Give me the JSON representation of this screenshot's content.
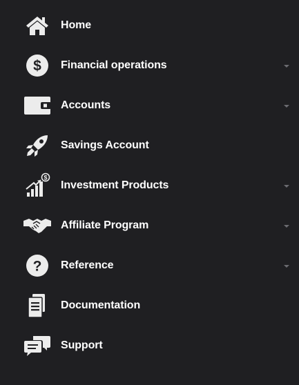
{
  "sidebar": {
    "items": [
      {
        "label": "Home",
        "icon": "home-icon",
        "has_submenu": false
      },
      {
        "label": "Financial operations",
        "icon": "dollar-icon",
        "has_submenu": true
      },
      {
        "label": "Accounts",
        "icon": "wallet-icon",
        "has_submenu": true
      },
      {
        "label": "Savings Account",
        "icon": "rocket-icon",
        "has_submenu": false
      },
      {
        "label": "Investment Products",
        "icon": "growth-chart-icon",
        "has_submenu": true
      },
      {
        "label": "Affiliate Program",
        "icon": "handshake-icon",
        "has_submenu": true
      },
      {
        "label": "Reference",
        "icon": "question-icon",
        "has_submenu": true
      },
      {
        "label": "Documentation",
        "icon": "document-icon",
        "has_submenu": false
      },
      {
        "label": "Support",
        "icon": "chat-icon",
        "has_submenu": false
      }
    ]
  },
  "colors": {
    "background": "#1f1f22",
    "text": "#ffffff",
    "icon": "#ececec",
    "chevron": "#6b6b70"
  }
}
